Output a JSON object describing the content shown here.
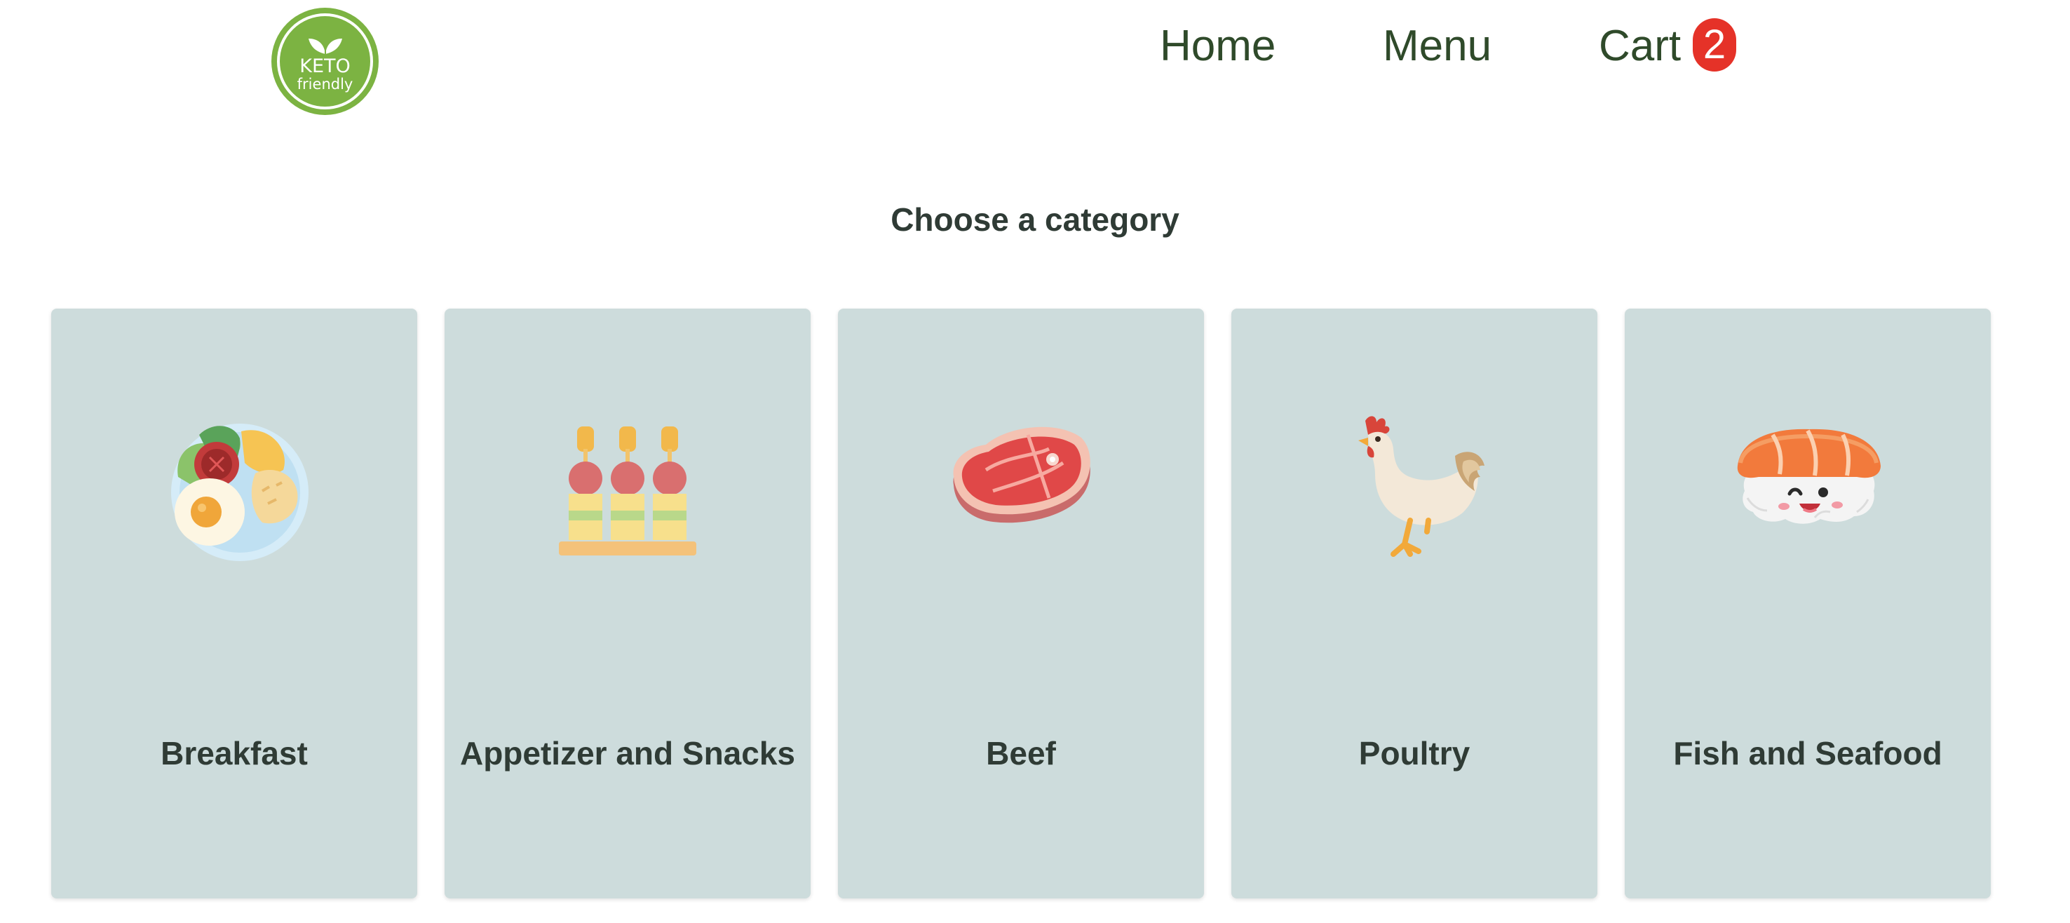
{
  "header": {
    "logo": {
      "line1": "KETO",
      "line2": "friendly",
      "color": "#7cb342"
    },
    "nav": {
      "home": "Home",
      "menu": "Menu",
      "cart": "Cart",
      "cart_count": "2"
    },
    "colors": {
      "nav_text": "#2f4a2a",
      "badge": "#e53228"
    }
  },
  "main": {
    "title": "Choose a category",
    "card_color": "#cddcdc",
    "categories": [
      {
        "label": "Breakfast",
        "icon": "breakfast-plate-icon"
      },
      {
        "label": "Appetizer and Snacks",
        "icon": "appetizer-skewers-icon"
      },
      {
        "label": "Beef",
        "icon": "steak-icon"
      },
      {
        "label": "Poultry",
        "icon": "chicken-icon"
      },
      {
        "label": "Fish and Seafood",
        "icon": "salmon-sushi-icon"
      }
    ]
  }
}
